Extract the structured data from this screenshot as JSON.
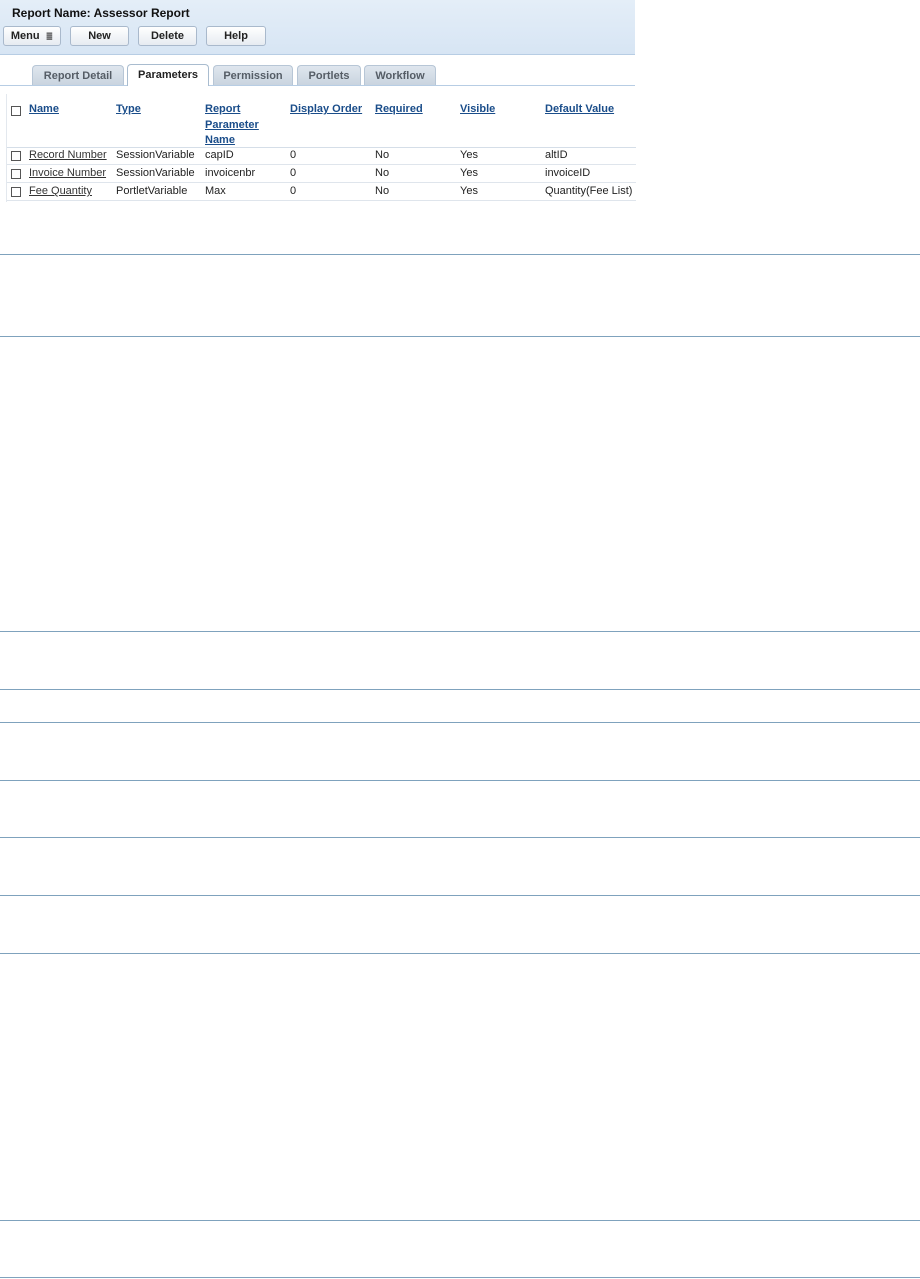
{
  "report": {
    "title": "Report Name: Assessor Report"
  },
  "toolbar": {
    "menu_label": "Menu",
    "menu_arrow": "≣",
    "new_label": "New",
    "delete_label": "Delete",
    "help_label": "Help"
  },
  "tabs": [
    {
      "label": "Report Detail",
      "active": false
    },
    {
      "label": "Parameters",
      "active": true
    },
    {
      "label": "Permission",
      "active": false
    },
    {
      "label": "Portlets",
      "active": false
    },
    {
      "label": "Workflow",
      "active": false
    }
  ],
  "table": {
    "headers": {
      "name": "Name",
      "type": "Type",
      "report_param_line1": "Report",
      "report_param_line2": "Parameter",
      "report_param_line3": "Name",
      "display_order": "Display Order",
      "required": "Required",
      "visible": "Visible",
      "default_value": "Default Value"
    },
    "rows": [
      {
        "name": "Record Number",
        "type": "SessionVariable",
        "param": "capID",
        "order": "0",
        "required": "No",
        "visible": "Yes",
        "default": "altID"
      },
      {
        "name": "Invoice Number",
        "type": "SessionVariable",
        "param": "invoicenbr",
        "order": "0",
        "required": "No",
        "visible": "Yes",
        "default": "invoiceID"
      },
      {
        "name": "Fee Quantity",
        "type": "PortletVariable",
        "param": "Max",
        "order": "0",
        "required": "No",
        "visible": "Yes",
        "default": "Quantity(Fee List)"
      }
    ]
  },
  "colors": {
    "header_bg": "#dce8f5",
    "link": "#1a4d8a",
    "separator": "#7fa2bd"
  }
}
